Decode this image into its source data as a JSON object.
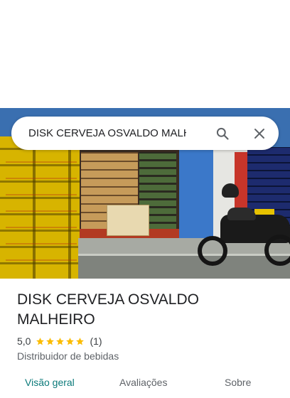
{
  "search": {
    "value": "DISK CERVEJA OSVALDO MALHEIRO",
    "search_icon": "search-icon",
    "close_icon": "close-icon"
  },
  "place": {
    "name_line1": "DISK CERVEJA OSVALDO",
    "name_line2": "MALHEIRO",
    "rating": "5,0",
    "stars": 5,
    "star_color": "#fbbc04",
    "review_count": "(1)",
    "category": "Distribuidor de bebidas"
  },
  "tabs": [
    {
      "label": "Visão geral",
      "active": true,
      "color": "#0b7a7a"
    },
    {
      "label": "Avaliações",
      "active": false
    },
    {
      "label": "Sobre",
      "active": false
    }
  ]
}
